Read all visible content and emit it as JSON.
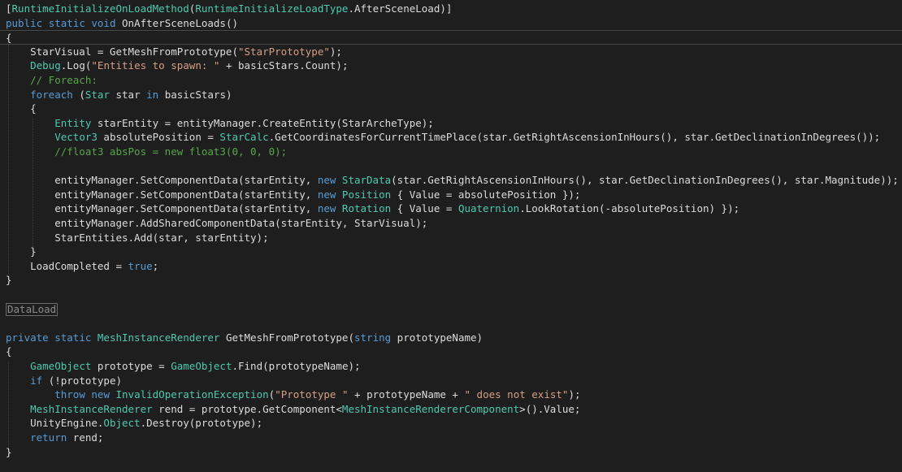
{
  "editor": {
    "colors": {
      "background": "#1e1e1e",
      "text": "#dcdcdc",
      "keyword": "#569cd6",
      "type": "#4ec9b0",
      "string": "#d69d85",
      "comment": "#57a64a",
      "region_tag": "#8a8a8a"
    },
    "lines": [
      [
        [
          "p",
          "["
        ],
        [
          "t",
          "RuntimeInitializeOnLoadMethod"
        ],
        [
          "p",
          "("
        ],
        [
          "t",
          "RuntimeInitializeLoadType"
        ],
        [
          "p",
          ".AfterSceneLoad)]"
        ]
      ],
      [
        [
          "k",
          "public"
        ],
        [
          "p",
          " "
        ],
        [
          "k",
          "static"
        ],
        [
          "p",
          " "
        ],
        [
          "k",
          "void"
        ],
        [
          "p",
          " OnAfterSceneLoads()"
        ]
      ],
      [
        [
          "p",
          "{"
        ]
      ],
      [
        [
          "p",
          "    StarVisual = GetMeshFromPrototype("
        ],
        [
          "s",
          "\"StarPrototype\""
        ],
        [
          "p",
          ");"
        ]
      ],
      [
        [
          "p",
          "    "
        ],
        [
          "t",
          "Debug"
        ],
        [
          "p",
          ".Log("
        ],
        [
          "s",
          "\"Entities to spawn: \""
        ],
        [
          "p",
          " + basicStars.Count);"
        ]
      ],
      [
        [
          "c",
          "    // Foreach:"
        ]
      ],
      [
        [
          "p",
          "    "
        ],
        [
          "k",
          "foreach"
        ],
        [
          "p",
          " ("
        ],
        [
          "t",
          "Star"
        ],
        [
          "p",
          " star "
        ],
        [
          "k",
          "in"
        ],
        [
          "p",
          " basicStars)"
        ]
      ],
      [
        [
          "p",
          "    {"
        ]
      ],
      [
        [
          "p",
          "        "
        ],
        [
          "t",
          "Entity"
        ],
        [
          "p",
          " starEntity = entityManager.CreateEntity(StarArcheType);"
        ]
      ],
      [
        [
          "p",
          "        "
        ],
        [
          "t",
          "Vector3"
        ],
        [
          "p",
          " absolutePosition = "
        ],
        [
          "t",
          "StarCalc"
        ],
        [
          "p",
          ".GetCoordinatesForCurrentTimePlace(star.GetRightAscensionInHours(), star.GetDeclinationInDegrees());"
        ]
      ],
      [
        [
          "c",
          "        //float3 absPos = new float3(0, 0, 0);"
        ]
      ],
      [
        [
          "p",
          ""
        ]
      ],
      [
        [
          "p",
          "        entityManager.SetComponentData(starEntity, "
        ],
        [
          "k",
          "new"
        ],
        [
          "p",
          " "
        ],
        [
          "t",
          "StarData"
        ],
        [
          "p",
          "(star.GetRightAscensionInHours(), star.GetDeclinationInDegrees(), star.Magnitude));"
        ]
      ],
      [
        [
          "p",
          "        entityManager.SetComponentData(starEntity, "
        ],
        [
          "k",
          "new"
        ],
        [
          "p",
          " "
        ],
        [
          "t",
          "Position"
        ],
        [
          "p",
          " { Value = absolutePosition });"
        ]
      ],
      [
        [
          "p",
          "        entityManager.SetComponentData(starEntity, "
        ],
        [
          "k",
          "new"
        ],
        [
          "p",
          " "
        ],
        [
          "t",
          "Rotation"
        ],
        [
          "p",
          " { Value = "
        ],
        [
          "t",
          "Quaternion"
        ],
        [
          "p",
          ".LookRotation(-absolutePosition) });"
        ]
      ],
      [
        [
          "p",
          "        entityManager.AddSharedComponentData(starEntity, StarVisual);"
        ]
      ],
      [
        [
          "p",
          "        StarEntities.Add(star, starEntity);"
        ]
      ],
      [
        [
          "p",
          "    }"
        ]
      ],
      [
        [
          "p",
          "    LoadCompleted = "
        ],
        [
          "k",
          "true"
        ],
        [
          "p",
          ";"
        ]
      ],
      [
        [
          "p",
          "}"
        ]
      ],
      [
        [
          "p",
          ""
        ]
      ],
      [
        [
          "r",
          "DataLoad"
        ]
      ],
      [
        [
          "p",
          ""
        ]
      ],
      [
        [
          "k",
          "private"
        ],
        [
          "p",
          " "
        ],
        [
          "k",
          "static"
        ],
        [
          "p",
          " "
        ],
        [
          "t",
          "MeshInstanceRenderer"
        ],
        [
          "p",
          " GetMeshFromPrototype("
        ],
        [
          "k",
          "string"
        ],
        [
          "p",
          " prototypeName)"
        ]
      ],
      [
        [
          "p",
          "{"
        ]
      ],
      [
        [
          "p",
          "    "
        ],
        [
          "t",
          "GameObject"
        ],
        [
          "p",
          " prototype = "
        ],
        [
          "t",
          "GameObject"
        ],
        [
          "p",
          ".Find(prototypeName);"
        ]
      ],
      [
        [
          "p",
          "    "
        ],
        [
          "k",
          "if"
        ],
        [
          "p",
          " (!prototype)"
        ]
      ],
      [
        [
          "p",
          "        "
        ],
        [
          "k",
          "throw"
        ],
        [
          "p",
          " "
        ],
        [
          "k",
          "new"
        ],
        [
          "p",
          " "
        ],
        [
          "t",
          "InvalidOperationException"
        ],
        [
          "p",
          "("
        ],
        [
          "s",
          "\"Prototype \""
        ],
        [
          "p",
          " + prototypeName + "
        ],
        [
          "s",
          "\" does not exist\""
        ],
        [
          "p",
          ");"
        ]
      ],
      [
        [
          "p",
          "    "
        ],
        [
          "t",
          "MeshInstanceRenderer"
        ],
        [
          "p",
          " rend = prototype.GetComponent<"
        ],
        [
          "t",
          "MeshInstanceRendererComponent"
        ],
        [
          "p",
          ">().Value;"
        ]
      ],
      [
        [
          "p",
          "    UnityEngine."
        ],
        [
          "t",
          "Object"
        ],
        [
          "p",
          ".Destroy(prototype);"
        ]
      ],
      [
        [
          "p",
          "    "
        ],
        [
          "k",
          "return"
        ],
        [
          "p",
          " rend;"
        ]
      ],
      [
        [
          "p",
          "}"
        ]
      ]
    ]
  }
}
